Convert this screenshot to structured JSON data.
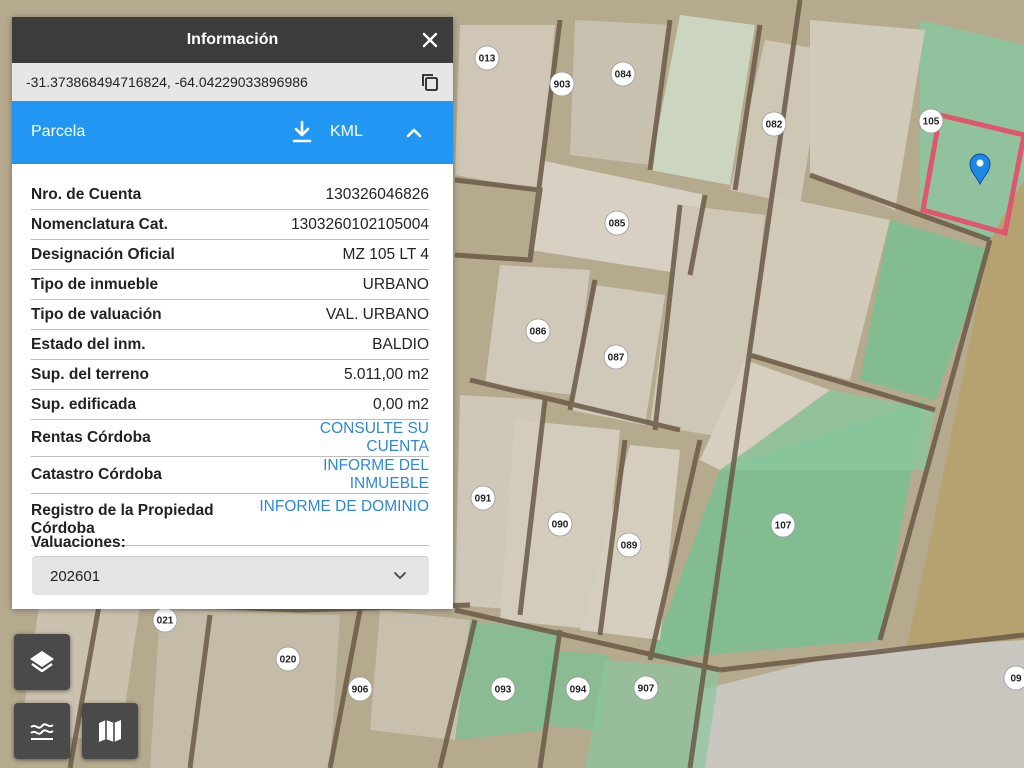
{
  "map": {
    "lot_labels": [
      "013",
      "903",
      "084",
      "082",
      "105",
      "085",
      "086",
      "087",
      "091",
      "090",
      "089",
      "107",
      "021",
      "020",
      "906",
      "093",
      "094",
      "907",
      "09"
    ],
    "colors": {
      "highlight": "#e0566e",
      "marker": "#1e88e5",
      "field_green": "#7bbf92"
    }
  },
  "panel": {
    "title": "Información",
    "close_icon": "close-icon",
    "coords": "-31.373868494716824, -64.04229033896986",
    "copy_icon": "copy-icon",
    "section_label": "Parcela",
    "download_icon": "download-icon",
    "kml_label": "KML",
    "collapse_icon": "chevron-up-icon",
    "rows": [
      {
        "key": "Nro. de Cuenta",
        "value": "130326046826"
      },
      {
        "key": "Nomenclatura Cat.",
        "value": "1303260102105004"
      },
      {
        "key": "Designación Oficial",
        "value": "MZ 105 LT 4"
      },
      {
        "key": "Tipo de inmueble",
        "value": "URBANO"
      },
      {
        "key": "Tipo de valuación",
        "value": "VAL. URBANO"
      },
      {
        "key": "Estado del inm.",
        "value": "BALDIO"
      },
      {
        "key": "Sup. del terreno",
        "value": "5.011,00 m2"
      },
      {
        "key": "Sup. edificada",
        "value": "0,00 m2"
      },
      {
        "key": "Rentas Córdoba",
        "value": "CONSULTE SU CUENTA"
      },
      {
        "key": "Catastro Córdoba",
        "value": "INFORME DEL INMUEBLE"
      },
      {
        "key": "Registro de la Propiedad Córdoba",
        "value": "INFORME DE DOMINIO"
      }
    ],
    "valuaciones_label": "Valuaciones:",
    "valuaciones_selected": "202601"
  },
  "controls": {
    "layers_icon": "layers-icon",
    "legend_icon": "contour-icon",
    "map_icon": "map-icon"
  }
}
